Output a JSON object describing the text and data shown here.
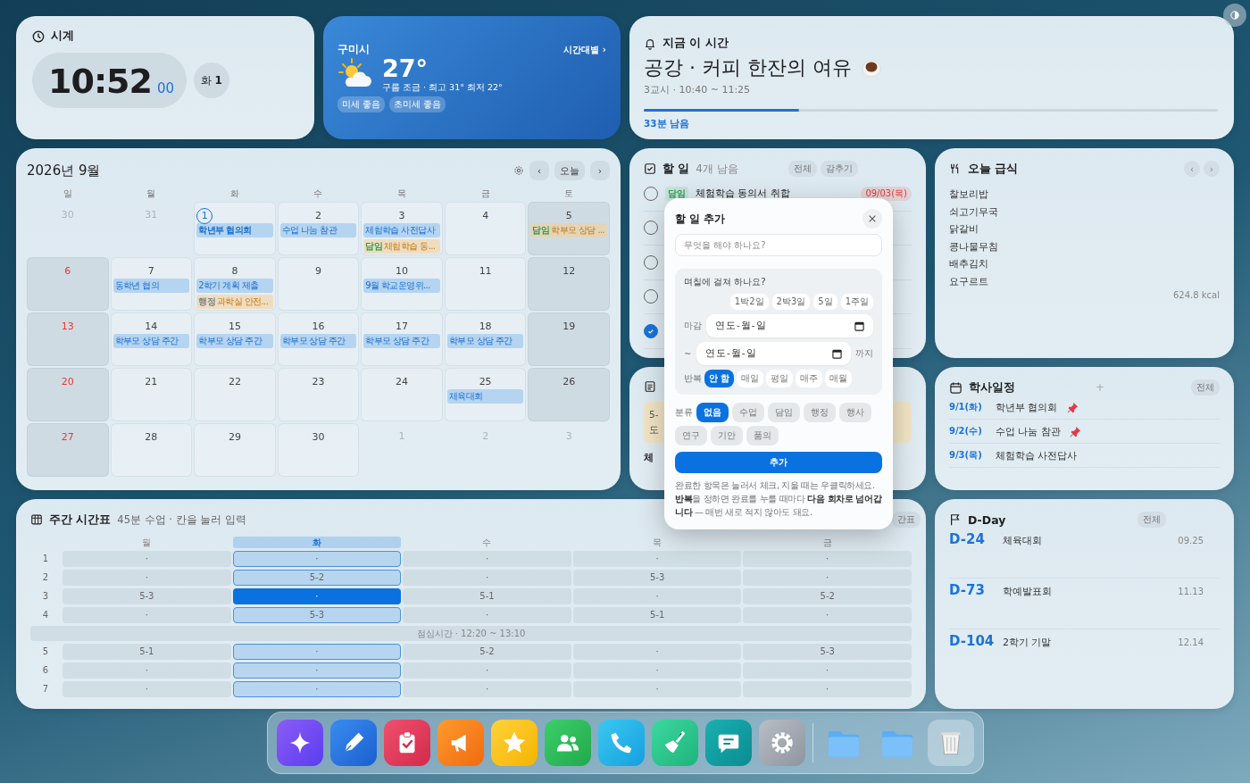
{
  "clock": {
    "title": "시계",
    "time": "10:52",
    "seconds": "00",
    "weekday": "화",
    "period": "1"
  },
  "weather": {
    "city": "구미시",
    "hourly_link": "시간대별 ›",
    "temperature": "27°",
    "summary": "구름 조금 · 최고 31° 최저 22°",
    "chips": [
      "미세 좋음",
      "초미세 좋음"
    ]
  },
  "now": {
    "title": "지금 이 시간",
    "activity": "공강 · 커피 한잔의 여유",
    "time_range": "3교시 · 10:40 ~ 11:25",
    "level": 0.27,
    "remaining": "33분 남음"
  },
  "calendar": {
    "title": "2026년 9월",
    "prev": "‹",
    "today_button": "오늘",
    "next": "›",
    "weekdays": [
      "일",
      "월",
      "화",
      "수",
      "목",
      "금",
      "토"
    ],
    "weeks": [
      [
        {
          "day": "30",
          "other_month": true,
          "today": false
        },
        {
          "day": "31",
          "other_month": true,
          "today": false
        },
        {
          "day": "1",
          "other_month": false,
          "today": true,
          "events": [
            {
              "kind": "event",
              "text": "학년부 협의회"
            }
          ]
        },
        {
          "day": "2",
          "other_month": false,
          "today": false,
          "events": [
            {
              "kind": "event",
              "text": "수업 나눔 참관"
            }
          ]
        },
        {
          "day": "3",
          "other_month": false,
          "today": false,
          "events": [
            {
              "kind": "event",
              "text": "체험학습 사전답사"
            },
            {
              "kind": "task",
              "tag": {
                "label": "담임",
                "color": "#2e9e4f"
              },
              "text": "체험학습 동..."
            }
          ]
        },
        {
          "day": "4",
          "other_month": false,
          "today": false
        },
        {
          "day": "5",
          "other_month": false,
          "today": false,
          "events": [
            {
              "kind": "task",
              "tag": {
                "label": "담임",
                "color": "#2e9e4f"
              },
              "text": "학부모 상담 ..."
            }
          ]
        }
      ],
      [
        {
          "day": "6",
          "other_month": false,
          "today": false
        },
        {
          "day": "7",
          "other_month": false,
          "today": false,
          "events": [
            {
              "kind": "event",
              "text": "동학년 협의"
            }
          ]
        },
        {
          "day": "8",
          "other_month": false,
          "today": false,
          "events": [
            {
              "kind": "event",
              "text": "2학기 계획 제출"
            },
            {
              "kind": "task",
              "tag": {
                "label": "행정",
                "color": "#7d838b"
              },
              "text": "과학실 안전..."
            }
          ]
        },
        {
          "day": "9",
          "other_month": false,
          "today": false
        },
        {
          "day": "10",
          "other_month": false,
          "today": false,
          "events": [
            {
              "kind": "event",
              "text": "9월 학교운영위..."
            }
          ]
        },
        {
          "day": "11",
          "other_month": false,
          "today": false
        },
        {
          "day": "12",
          "other_month": false,
          "today": false
        }
      ],
      [
        {
          "day": "13",
          "other_month": false,
          "today": false
        },
        {
          "day": "14",
          "other_month": false,
          "today": false,
          "events": [
            {
              "kind": "event",
              "text": "학부모 상담 주간"
            }
          ]
        },
        {
          "day": "15",
          "other_month": false,
          "today": false,
          "events": [
            {
              "kind": "event",
              "text": "학부모 상담 주간"
            }
          ]
        },
        {
          "day": "16",
          "other_month": false,
          "today": false,
          "events": [
            {
              "kind": "event",
              "text": "학부모 상담 주간"
            }
          ]
        },
        {
          "day": "17",
          "other_month": false,
          "today": false,
          "events": [
            {
              "kind": "event",
              "text": "학부모 상담 주간"
            }
          ]
        },
        {
          "day": "18",
          "other_month": false,
          "today": false,
          "events": [
            {
              "kind": "event",
              "text": "학부모 상담 주간"
            }
          ]
        },
        {
          "day": "19",
          "other_month": false,
          "today": false
        }
      ],
      [
        {
          "day": "20",
          "other_month": false,
          "today": false
        },
        {
          "day": "21",
          "other_month": false,
          "today": false
        },
        {
          "day": "22",
          "other_month": false,
          "today": false
        },
        {
          "day": "23",
          "other_month": false,
          "today": false
        },
        {
          "day": "24",
          "other_month": false,
          "today": false
        },
        {
          "day": "25",
          "other_month": false,
          "today": false,
          "events": [
            {
              "kind": "event",
              "text": "체육대회"
            }
          ]
        },
        {
          "day": "26",
          "other_month": false,
          "today": false
        }
      ],
      [
        {
          "day": "27",
          "other_month": false,
          "today": false
        },
        {
          "day": "28",
          "other_month": false,
          "today": false
        },
        {
          "day": "29",
          "other_month": false,
          "today": false
        },
        {
          "day": "30",
          "other_month": false,
          "today": false
        },
        {
          "day": "1",
          "other_month": true,
          "today": false
        },
        {
          "day": "2",
          "other_month": true,
          "today": false
        },
        {
          "day": "3",
          "other_month": true,
          "today": false
        }
      ]
    ]
  },
  "todo": {
    "title": "할 일",
    "remaining": "4개 남음",
    "buttons": [
      "전체",
      "감추기"
    ],
    "items": [
      {
        "checked": false,
        "tag": {
          "label": "담임",
          "color": "#2e9e4f"
        },
        "text": "체험학습 동의서 취합",
        "due": "09/03(목)"
      },
      {
        "checked": false
      },
      {
        "checked": false
      },
      {
        "checked": false
      },
      {
        "checked": true
      }
    ]
  },
  "memo": {
    "note_lines": [
      "5-",
      "도"
    ],
    "heading": "체"
  },
  "meal": {
    "title": "오늘 급식",
    "prev": "‹",
    "next": "›",
    "items": [
      "찰보리밥",
      "쇠고기무국",
      "닭갈비",
      "콩나물무침",
      "배추김치",
      "요구르트"
    ],
    "calories": "624.8 kcal"
  },
  "schedule": {
    "title": "학사일정",
    "add": "+",
    "all_button": "전체",
    "items": [
      {
        "date": "9/1(화)",
        "text": "학년부 협의회",
        "pinned": true
      },
      {
        "date": "9/2(수)",
        "text": "수업 나눔 참관",
        "pinned": true
      },
      {
        "date": "9/3(목)",
        "text": "체험학습 사전답사",
        "pinned": false
      }
    ]
  },
  "timetable": {
    "title": "주간 시간표",
    "subtitle": "45분 수업 · 칸을 눌러 입력",
    "button": "간표",
    "days": [
      {
        "label": "월",
        "selected": false
      },
      {
        "label": "화",
        "selected": true
      },
      {
        "label": "수",
        "selected": false
      },
      {
        "label": "목",
        "selected": false
      },
      {
        "label": "금",
        "selected": false
      }
    ],
    "rows": [
      {
        "kind": "period",
        "label": "1",
        "cells": [
          {
            "text": "·",
            "current": false
          },
          {
            "text": "·",
            "current": false
          },
          {
            "text": "·",
            "current": false
          },
          {
            "text": "·",
            "current": false
          },
          {
            "text": "·",
            "current": false
          }
        ]
      },
      {
        "kind": "period",
        "label": "2",
        "cells": [
          {
            "text": "·",
            "current": false
          },
          {
            "text": "5-2",
            "current": false
          },
          {
            "text": "·",
            "current": false
          },
          {
            "text": "5-3",
            "current": false
          },
          {
            "text": "·",
            "current": false
          }
        ]
      },
      {
        "kind": "period",
        "label": "3",
        "cells": [
          {
            "text": "5-3",
            "current": false
          },
          {
            "text": "·",
            "current": true
          },
          {
            "text": "5-1",
            "current": false
          },
          {
            "text": "·",
            "current": false
          },
          {
            "text": "5-2",
            "current": false
          }
        ]
      },
      {
        "kind": "period",
        "label": "4",
        "cells": [
          {
            "text": "·",
            "current": false
          },
          {
            "text": "5-3",
            "current": false
          },
          {
            "text": "·",
            "current": false
          },
          {
            "text": "5-1",
            "current": false
          },
          {
            "text": "·",
            "current": false
          }
        ]
      },
      {
        "kind": "lunch",
        "label": "점심시간 · 12:20 ~ 13:10"
      },
      {
        "kind": "period",
        "label": "5",
        "cells": [
          {
            "text": "5-1",
            "current": false
          },
          {
            "text": "·",
            "current": false
          },
          {
            "text": "5-2",
            "current": false
          },
          {
            "text": "·",
            "current": false
          },
          {
            "text": "5-3",
            "current": false
          }
        ]
      },
      {
        "kind": "period",
        "label": "6",
        "cells": [
          {
            "text": "·",
            "current": false
          },
          {
            "text": "·",
            "current": false
          },
          {
            "text": "·",
            "current": false
          },
          {
            "text": "·",
            "current": false
          },
          {
            "text": "·",
            "current": false
          }
        ]
      },
      {
        "kind": "period",
        "label": "7",
        "cells": [
          {
            "text": "·",
            "current": false
          },
          {
            "text": "·",
            "current": false
          },
          {
            "text": "·",
            "current": false
          },
          {
            "text": "·",
            "current": false
          },
          {
            "text": "·",
            "current": false
          }
        ]
      }
    ]
  },
  "dday": {
    "title": "D-Day",
    "all_button": "전체",
    "items": [
      {
        "count": "D-24",
        "name": "체육대회",
        "date": "09.25"
      },
      {
        "count": "D-73",
        "name": "학예발표회",
        "date": "11.13"
      },
      {
        "count": "D-104",
        "name": "2학기 기말",
        "date": "12.14"
      }
    ]
  },
  "modal": {
    "title": "할 일 추가",
    "placeholder": "무엇을 해야 하나요?",
    "span_question": "며칠에 걸쳐 하나요?",
    "span_presets": [
      "1박2일",
      "2박3일",
      "5일",
      "1주일"
    ],
    "due_label": "마감",
    "due_placeholder": "연도-월-일",
    "range_sep": "~",
    "end_placeholder": "연도-월-일",
    "end_suffix": "까지",
    "repeat_label": "반복",
    "repeat_options": [
      {
        "label": "안 함",
        "selected": true
      },
      {
        "label": "매일",
        "selected": false
      },
      {
        "label": "평일",
        "selected": false
      },
      {
        "label": "매주",
        "selected": false
      },
      {
        "label": "매월",
        "selected": false
      }
    ],
    "category_label": "분류",
    "categories": [
      {
        "label": "없음",
        "selected": true
      },
      {
        "label": "수업",
        "selected": false
      },
      {
        "label": "담임",
        "selected": false
      },
      {
        "label": "행정",
        "selected": false
      },
      {
        "label": "행사",
        "selected": false
      },
      {
        "label": "연구",
        "selected": false
      },
      {
        "label": "기안",
        "selected": false
      },
      {
        "label": "품의",
        "selected": false
      }
    ],
    "submit": "추가",
    "help": [
      "완료한 항목은 눌러서 체크, 지울 때는 우클릭하세요.",
      "**반복**을 정하면 완료를 누를 때마다 **다음 회차로 넘어갑니다** — 매번 새로 적지 않아도 돼요."
    ]
  }
}
